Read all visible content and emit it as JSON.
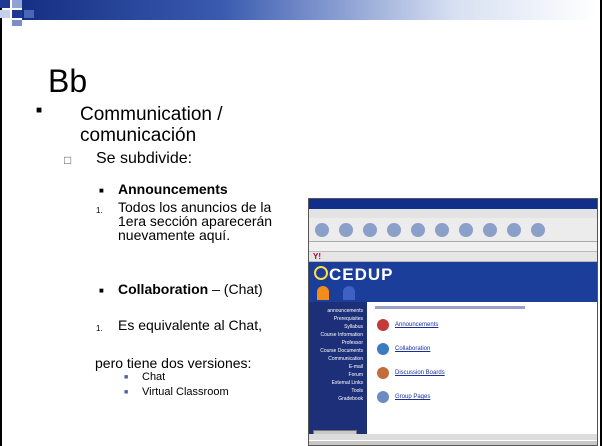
{
  "slide": {
    "title": "Bb",
    "level1": "Communication / comunicación",
    "level2": "Se subdivide:",
    "item_announcements": "Announcements",
    "num1": "1.",
    "text_announcements": "Todos los anuncios de la 1era sección aparecerán nuevamente aquí.",
    "item_collaboration": "Collaboration",
    "collab_suffix": " – (Chat)",
    "num2": "1.",
    "text_equivalente": "Es equivalente al Chat,",
    "text_versions": "pero tiene dos versiones:",
    "sub_chat": "Chat",
    "sub_virtual": "Virtual Classroom"
  },
  "screenshot": {
    "brand": "CEDUP",
    "menu_links": [
      "Announcements",
      "Collaboration",
      "Discussion Boards",
      "Group Pages"
    ],
    "nav_items": [
      "announcements",
      "Prerequisites",
      "Syllabus",
      "Course Information",
      "Professor",
      "Course Documents",
      "Communication",
      "E-mail",
      "Forum",
      "External Links",
      "Tools",
      "Gradebook"
    ]
  },
  "colors": {
    "banner": "#1b3e9b",
    "accent_tab": "#f28c1b"
  }
}
